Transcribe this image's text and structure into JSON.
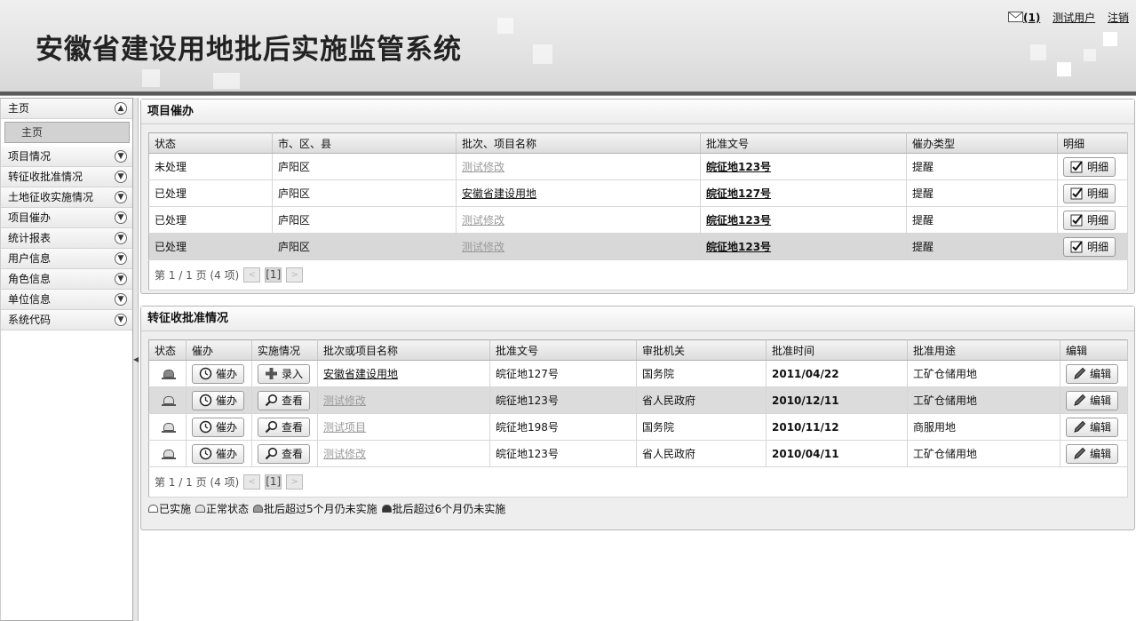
{
  "app": {
    "title": "安徽省建设用地批后实施监管系统"
  },
  "userbar": {
    "mail_count": "(1)",
    "user": "测试用户",
    "logout": "注销"
  },
  "sidebar": {
    "items": [
      {
        "label": "主页",
        "expanded": true
      },
      {
        "label": "项目情况"
      },
      {
        "label": "转征收批准情况"
      },
      {
        "label": "土地征收实施情况"
      },
      {
        "label": "项目催办"
      },
      {
        "label": "统计报表"
      },
      {
        "label": "用户信息"
      },
      {
        "label": "角色信息"
      },
      {
        "label": "单位信息"
      },
      {
        "label": "系统代码"
      }
    ],
    "sub_item": "主页"
  },
  "panel1": {
    "title": "项目催办",
    "columns": [
      "状态",
      "市、区、县",
      "批次、项目名称",
      "批准文号",
      "催办类型",
      "明细"
    ],
    "rows": [
      {
        "status": "未处理",
        "area": "庐阳区",
        "name": "测试修改",
        "doc": "皖征地123号",
        "type": "提醒",
        "detail": "明细"
      },
      {
        "status": "已处理",
        "area": "庐阳区",
        "name": "安徽省建设用地",
        "doc": "皖征地127号",
        "type": "提醒",
        "detail": "明细"
      },
      {
        "status": "已处理",
        "area": "庐阳区",
        "name": "测试修改",
        "doc": "皖征地123号",
        "type": "提醒",
        "detail": "明细"
      },
      {
        "status": "已处理",
        "area": "庐阳区",
        "name": "测试修改",
        "doc": "皖征地123号",
        "type": "提醒",
        "detail": "明细"
      }
    ],
    "pager": {
      "text": "第 1 / 1 页 (4 项)",
      "page": "[1]"
    }
  },
  "panel2": {
    "title": "转征收批准情况",
    "columns": [
      "状态",
      "催办",
      "实施情况",
      "批次或项目名称",
      "批准文号",
      "审批机关",
      "批准时间",
      "批准用途",
      "编辑"
    ],
    "rows": [
      {
        "urge": "催办",
        "impl": "录入",
        "name": "安徽省建设用地",
        "doc": "皖征地127号",
        "org": "国务院",
        "date": "2011/04/22",
        "use": "工矿仓储用地",
        "edit": "编辑"
      },
      {
        "urge": "催办",
        "impl": "查看",
        "name": "测试修改",
        "doc": "皖征地123号",
        "org": "省人民政府",
        "date": "2010/12/11",
        "use": "工矿仓储用地",
        "edit": "编辑"
      },
      {
        "urge": "催办",
        "impl": "查看",
        "name": "测试项目",
        "doc": "皖征地198号",
        "org": "国务院",
        "date": "2010/11/12",
        "use": "商服用地",
        "edit": "编辑"
      },
      {
        "urge": "催办",
        "impl": "查看",
        "name": "测试修改",
        "doc": "皖征地123号",
        "org": "省人民政府",
        "date": "2010/04/11",
        "use": "工矿仓储用地",
        "edit": "编辑"
      }
    ],
    "pager": {
      "text": "第 1 / 1 页 (4 项)",
      "page": "[1]"
    },
    "legend": [
      "已实施",
      "正常状态",
      "批后超过5个月仍未实施",
      "批后超过6个月仍未实施"
    ]
  }
}
